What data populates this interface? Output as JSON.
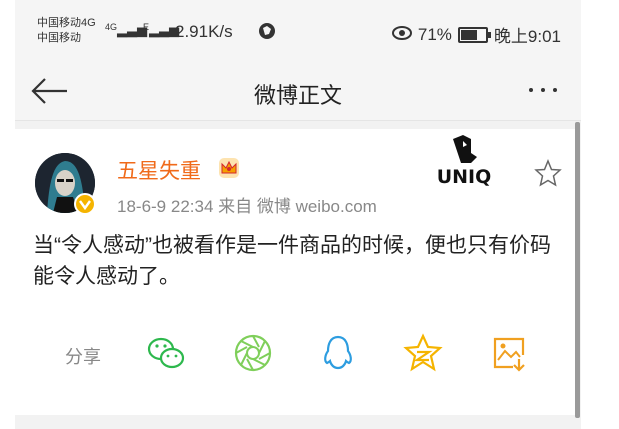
{
  "status_bar": {
    "carrier_line1": "中国移动4G",
    "carrier_line2": "中国移动",
    "signal1": "4G",
    "signal2": "E",
    "net_speed": "2.91K/s",
    "battery": "71%",
    "battery_level": 0.71,
    "time": "晚上9:01"
  },
  "nav": {
    "title": "微博正文"
  },
  "post": {
    "username": "五星失重",
    "meta": "18-6-9 22:34  来自 微博 weibo.com",
    "text": "当“令人感动”也被看作是一件商品的时候，便也只有价码能令人感动了。",
    "share_label": "分享"
  },
  "colors": {
    "accent_orange": "#f06a1a",
    "wechat_green": "#2db84d",
    "moments_green": "#7fcf5a",
    "qq_blue": "#2d9de0",
    "qzone_yellow": "#f5b400",
    "save_orange": "#f0a020"
  },
  "icons": [
    "back-arrow-icon",
    "more-icon",
    "crown-icon",
    "star-icon",
    "wechat-icon",
    "moments-icon",
    "qq-icon",
    "qzone-icon",
    "save-image-icon",
    "brand-logo-uniq"
  ]
}
